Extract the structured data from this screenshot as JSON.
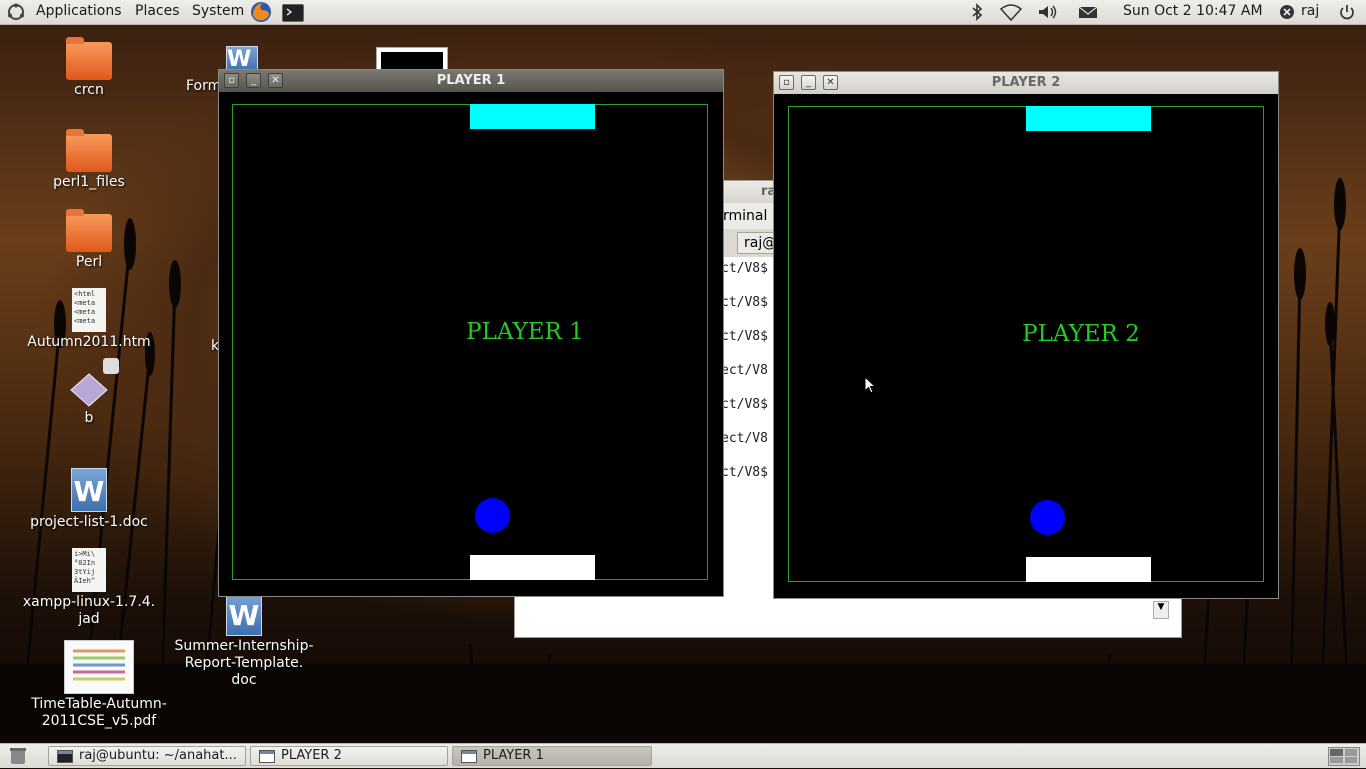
{
  "top_panel": {
    "menus": [
      "Applications",
      "Places",
      "System"
    ],
    "clock": "Sun Oct  2 10:47 AM",
    "user": "raj",
    "icons": [
      "ubuntu-logo-icon",
      "firefox-icon",
      "terminal-icon",
      "bluetooth-icon",
      "wifi-icon",
      "volume-icon",
      "mail-icon",
      "user-icon",
      "power-icon"
    ]
  },
  "desktop": {
    "icons": [
      {
        "label": "crcn",
        "type": "folder"
      },
      {
        "label": "perl1_files",
        "type": "folder"
      },
      {
        "label": "Perl",
        "type": "folder"
      },
      {
        "label": "Autumn2011.htm",
        "type": "html"
      },
      {
        "label": "b",
        "type": "package"
      },
      {
        "label": "project-list-1.doc",
        "type": "doc"
      },
      {
        "label": "xampp-linux-1.7.4.\njad",
        "type": "text"
      },
      {
        "label": "TimeTable-Autumn-\n2011CSE_v5.pdf",
        "type": "pdf"
      },
      {
        "label": "Summer-Internship-\nReport-Template.\ndoc",
        "type": "doc"
      },
      {
        "label": "Form",
        "type": "doc"
      },
      {
        "label": "k",
        "type": "partial"
      }
    ],
    "html_snippet": [
      "<html",
      "<meta",
      "<meta",
      "<meta"
    ],
    "jad_snippet": [
      "i>Mi\\",
      "°02In",
      "3tYij",
      "ÄIeh^"
    ]
  },
  "terminal": {
    "title": "ra",
    "menu_partial": "rminal",
    "tab_label": "raj@",
    "lines": [
      "ct/V8$",
      "ct/V8$",
      "ct/V8$",
      "ect/V8",
      "ct/V8$",
      "ect/V8",
      "ct/V8$"
    ]
  },
  "windows": {
    "player1": {
      "title": "PLAYER 1",
      "label": "PLAYER 1",
      "active": true
    },
    "player2": {
      "title": "PLAYER 2",
      "label": "PLAYER 2",
      "active": false
    }
  },
  "colors": {
    "paddle_top": "#00ffff",
    "paddle_bottom": "#ffffff",
    "ball": "#0000ff",
    "border": "#2aa12a",
    "label": "#22cc22"
  },
  "taskbar": {
    "items": [
      {
        "label": "raj@ubuntu: ~/anahat...",
        "active": false
      },
      {
        "label": "PLAYER 2",
        "active": false
      },
      {
        "label": "PLAYER 1",
        "active": true
      }
    ]
  }
}
